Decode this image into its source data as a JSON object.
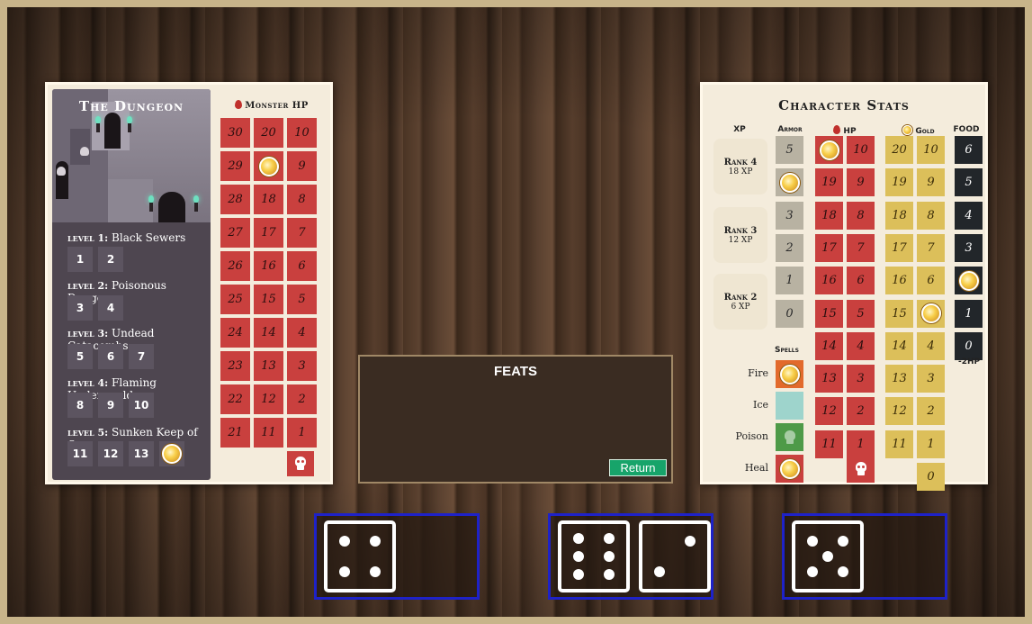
{
  "dungeon": {
    "title": "The Dungeon",
    "monster_hp_title": "Monster HP",
    "levels": [
      {
        "key": "level 1:",
        "name": "Black Sewers",
        "boxes": [
          "1",
          "2"
        ]
      },
      {
        "key": "level 2:",
        "name": "Poisonous Dungeon",
        "boxes": [
          "3",
          "4"
        ]
      },
      {
        "key": "level 3:",
        "name": "Undead Catacombs",
        "boxes": [
          "5",
          "6",
          "7"
        ]
      },
      {
        "key": "level 4:",
        "name": "Flaming Underworld",
        "boxes": [
          "8",
          "9",
          "10"
        ]
      },
      {
        "key": "level 5:",
        "name": "Sunken Keep of Og",
        "boxes": [
          "11",
          "12",
          "13"
        ],
        "marker": "coin-marker-icon"
      }
    ],
    "monster_hp": [
      [
        "30",
        "20",
        "10"
      ],
      [
        "29",
        "coin",
        "9"
      ],
      [
        "28",
        "18",
        "8"
      ],
      [
        "27",
        "17",
        "7"
      ],
      [
        "26",
        "16",
        "6"
      ],
      [
        "25",
        "15",
        "5"
      ],
      [
        "24",
        "14",
        "4"
      ],
      [
        "23",
        "13",
        "3"
      ],
      [
        "22",
        "12",
        "2"
      ],
      [
        "21",
        "11",
        "1"
      ]
    ]
  },
  "feats": {
    "title": "FEATS",
    "return_label": "Return"
  },
  "stats": {
    "title": "Character Stats",
    "headers": {
      "xp": "XP",
      "armor": "Armor",
      "hp": "HP",
      "gold": "Gold",
      "food": "FOOD"
    },
    "ranks": [
      {
        "name": "Rank 4",
        "xp": "18 XP"
      },
      {
        "name": "Rank 3",
        "xp": "12 XP"
      },
      {
        "name": "Rank 2",
        "xp": "6 XP"
      }
    ],
    "armor": [
      "5",
      "coin",
      "3",
      "2",
      "1",
      "0"
    ],
    "hp_col1": [
      "coin",
      "19",
      "18",
      "17",
      "16",
      "15",
      "14",
      "13",
      "12",
      "11"
    ],
    "hp_col2": [
      "10",
      "9",
      "8",
      "7",
      "6",
      "5",
      "4",
      "3",
      "2",
      "1"
    ],
    "gold_col1": [
      "20",
      "19",
      "18",
      "17",
      "16",
      "15",
      "14",
      "13",
      "12",
      "11"
    ],
    "gold_col2": [
      "10",
      "9",
      "8",
      "7",
      "6",
      "coin",
      "4",
      "3",
      "2",
      "1",
      "0"
    ],
    "food": [
      "6",
      "5",
      "4",
      "3",
      "coin",
      "1",
      "0"
    ],
    "food_note": "-2HP",
    "spells_label": "Spells",
    "spells": [
      "Fire",
      "Ice",
      "Poison",
      "Heal"
    ]
  },
  "dice": {
    "tray1": [
      4
    ],
    "tray2": [
      6,
      2
    ],
    "tray3": [
      5
    ]
  },
  "colors": {
    "monster_hp": "#c9403e",
    "gold": "#dcbf5a",
    "armor": "#b8b2a2",
    "food": "#22262a",
    "tray_border": "#1e22c8",
    "return_button": "#17a46a"
  }
}
